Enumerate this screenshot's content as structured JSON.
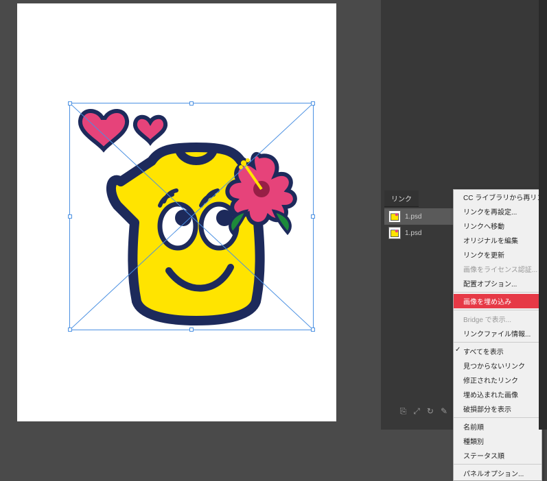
{
  "panel": {
    "tab_label": "リンク",
    "items": [
      {
        "filename": "1.psd",
        "selected": true
      },
      {
        "filename": "1.psd",
        "selected": false
      }
    ],
    "footer_icons": [
      "link-icon",
      "refresh-icon",
      "edit-icon",
      "goto-icon",
      "pencil-icon"
    ]
  },
  "context_menu": {
    "items": [
      {
        "label": "CC ライブラリから再リンク...",
        "type": "normal"
      },
      {
        "label": "リンクを再設定...",
        "type": "normal"
      },
      {
        "label": "リンクへ移動",
        "type": "normal"
      },
      {
        "label": "オリジナルを編集",
        "type": "normal"
      },
      {
        "label": "リンクを更新",
        "type": "normal"
      },
      {
        "label": "画像をライセンス認証...",
        "type": "disabled"
      },
      {
        "label": "配置オプション...",
        "type": "normal"
      },
      {
        "type": "sep"
      },
      {
        "label": "画像を埋め込み",
        "type": "highlighted"
      },
      {
        "type": "sep"
      },
      {
        "label": "Bridge で表示...",
        "type": "disabled"
      },
      {
        "label": "リンクファイル情報...",
        "type": "normal"
      },
      {
        "type": "sep"
      },
      {
        "label": "すべてを表示",
        "type": "check"
      },
      {
        "label": "見つからないリンク",
        "type": "normal"
      },
      {
        "label": "修正されたリンク",
        "type": "normal"
      },
      {
        "label": "埋め込まれた画像",
        "type": "normal"
      },
      {
        "label": "破損部分を表示",
        "type": "normal"
      },
      {
        "type": "sep"
      },
      {
        "label": "名前順",
        "type": "normal"
      },
      {
        "label": "種類別",
        "type": "normal"
      },
      {
        "label": "ステータス順",
        "type": "normal"
      },
      {
        "type": "sep"
      },
      {
        "label": "パネルオプション...",
        "type": "normal"
      }
    ]
  },
  "artwork": {
    "description": "yellow t-shirt character with face, pink hearts, pink hibiscus flower",
    "colors": {
      "shirt": "#ffe400",
      "outline": "#1d2a5b",
      "pink": "#e6437a",
      "flower_center": "#971f46"
    }
  }
}
